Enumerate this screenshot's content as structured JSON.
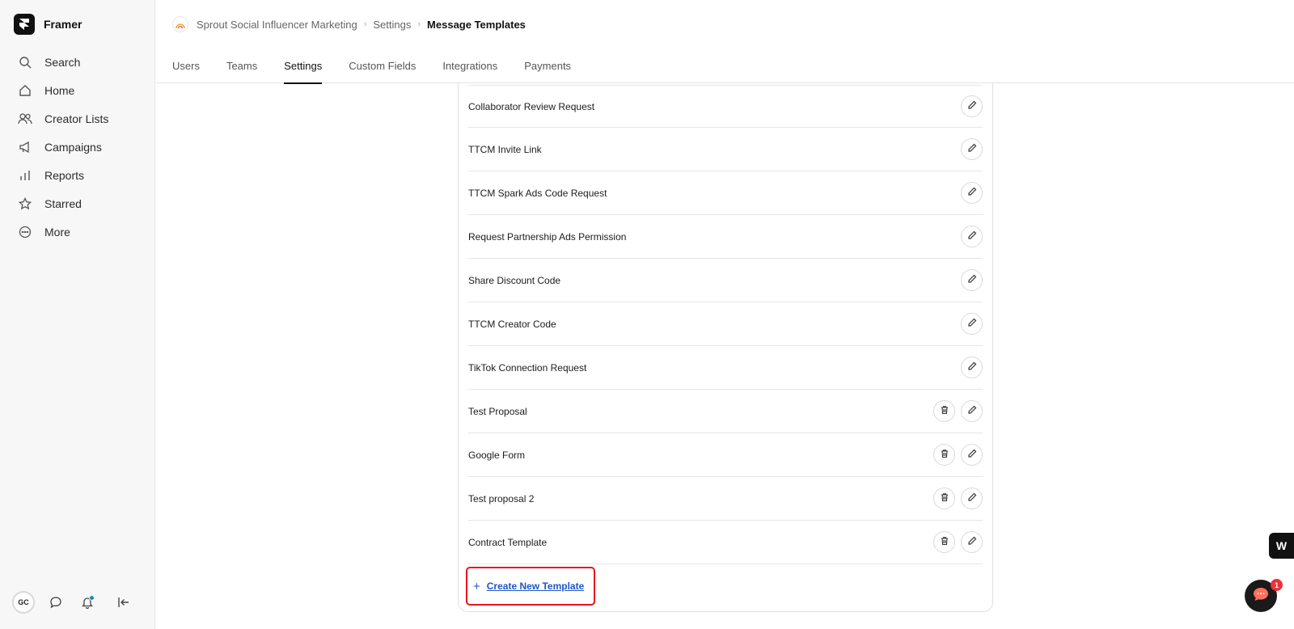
{
  "app": {
    "name": "Framer"
  },
  "sidebar": {
    "items": [
      {
        "label": "Search",
        "icon": "search-icon"
      },
      {
        "label": "Home",
        "icon": "home-icon"
      },
      {
        "label": "Creator Lists",
        "icon": "users-icon"
      },
      {
        "label": "Campaigns",
        "icon": "megaphone-icon"
      },
      {
        "label": "Reports",
        "icon": "bar-chart-icon"
      },
      {
        "label": "Starred",
        "icon": "star-icon"
      },
      {
        "label": "More",
        "icon": "more-icon"
      }
    ],
    "user_initials": "GC"
  },
  "breadcrumb": {
    "org": "Sprout Social Influencer Marketing",
    "section": "Settings",
    "current": "Message Templates"
  },
  "tabs": [
    {
      "label": "Users"
    },
    {
      "label": "Teams"
    },
    {
      "label": "Settings",
      "active": true
    },
    {
      "label": "Custom Fields"
    },
    {
      "label": "Integrations"
    },
    {
      "label": "Payments"
    }
  ],
  "templates": [
    {
      "name": "Collaborator Review Request",
      "deletable": false
    },
    {
      "name": "TTCM Invite Link",
      "deletable": false
    },
    {
      "name": "TTCM Spark Ads Code Request",
      "deletable": false
    },
    {
      "name": "Request Partnership Ads Permission",
      "deletable": false
    },
    {
      "name": "Share Discount Code",
      "deletable": false
    },
    {
      "name": "TTCM Creator Code",
      "deletable": false
    },
    {
      "name": "TikTok Connection Request",
      "deletable": false
    },
    {
      "name": "Test Proposal",
      "deletable": true
    },
    {
      "name": "Google Form",
      "deletable": true
    },
    {
      "name": "Test proposal 2",
      "deletable": true
    },
    {
      "name": "Contract Template",
      "deletable": true
    }
  ],
  "create_button": {
    "plus": "+",
    "label": "Create New Template"
  },
  "widgets": {
    "w_badge": "W",
    "chat_count": "1"
  },
  "colors": {
    "link": "#1e56c7",
    "highlight": "#e8141e",
    "notification": "#1a8bbf",
    "badge": "#e8333d"
  }
}
